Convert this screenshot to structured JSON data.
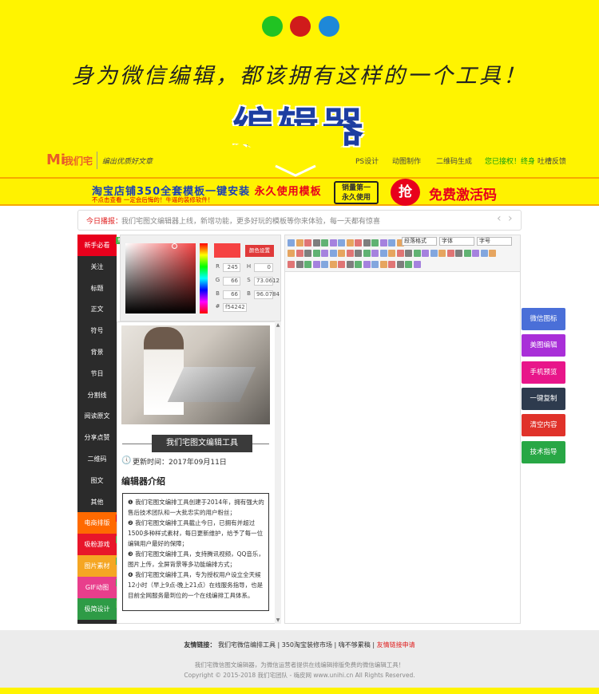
{
  "hero": {
    "dot_colors": [
      "#21c323",
      "#d01b1b",
      "#1e88d8"
    ],
    "caption": "身为微信编辑，都该拥有这样的一个工具！",
    "title": "编辑器"
  },
  "nav": {
    "logo_mark": "Mi",
    "logo_text": "我们宅",
    "slogan": "编出优质好文章",
    "items": [
      "PS设计",
      "动图制作",
      "二维码生成",
      "您已接权！终身",
      "吐槽反馈"
    ]
  },
  "banner": {
    "main_a": "淘宝店铺350全套模板一键安装",
    "main_b": "永久使用模板",
    "sub": "不点击查看 一定会后悔的！牛逼的装修软件！",
    "box_line1": "销量第一",
    "box_line2": "永久使用",
    "circle": "抢",
    "free": "免费激活码"
  },
  "notice": {
    "label": "今日播报：",
    "text": "我们宅图文编辑器上线，新增功能，更多好玩的模板等你来体验，每一天都有惊喜"
  },
  "sidebar": {
    "items": [
      "新手必看",
      "关注",
      "标题",
      "正文",
      "符号",
      "背景",
      "节日",
      "分割线",
      "阅读原文",
      "分享点赞",
      "二维码",
      "图文",
      "其他",
      "电商排版",
      "吸粉游戏",
      "图片素材",
      "GIF动图",
      "极简设计"
    ],
    "tags": [
      "推荐",
      "VIP",
      "推荐",
      "推荐",
      "推荐",
      "推荐"
    ]
  },
  "picker": {
    "color_set": "颜色设置",
    "fields": {
      "R": "245",
      "G": "66",
      "B": "66",
      "H": "0",
      "S": "73.0612",
      "Bv": "96.0784",
      "hex": "f54242"
    },
    "current_color": "#f54242"
  },
  "preview": {
    "title": "我们宅图文编辑工具",
    "time_label": "更新时间：2017年09月11日",
    "section": "编辑器介绍",
    "paras": [
      "❶ 我们宅图文编排工具创建于2014年，拥有强大的售后技术团队和一大批忠实的用户粉丝；",
      "❷ 我们宅图文编排工具截止今日，已拥有并超过1500多种样式素材，每日更新维护，给予了每一位编辑用户最好的保障；",
      "❸ 我们宅图文编排工具，支持腾讯视频，QQ音乐，图片上传，全屏背景等多功能编排方式；",
      "❹ 我们宅图文编排工具，专为授权用户设立全天候12小时（早上9点-晚上21点）在线服务指导，也是目前全网服务最到位的一个在线编排工具体系。"
    ]
  },
  "editor": {
    "para_format": "段落格式",
    "font_family": "字体",
    "font_size": "字号"
  },
  "right_buttons": [
    {
      "label": "微信图标",
      "color": "#4a6fd8"
    },
    {
      "label": "美图编辑",
      "color": "#a92fd8"
    },
    {
      "label": "手机预览",
      "color": "#e8168a"
    },
    {
      "label": "一键复制",
      "color": "#2e3b4e"
    },
    {
      "label": "清空内容",
      "color": "#e0322a"
    },
    {
      "label": "技术指导",
      "color": "#28a745"
    }
  ],
  "footer": {
    "links_label": "友情链接：",
    "link1": "我们宅微信编排工具",
    "link2": "350淘宝装修市场",
    "link3": "嗨不够累稿",
    "link4": "友情链接申请",
    "line2": "我们宅微信图文编辑器，为微信运营者提供在线编辑排版免费的微信编辑工具！",
    "line3": "Copyright © 2015-2018 我们宅团队 - 嗨皮网 www.unihi.cn All Rights Reserved."
  }
}
